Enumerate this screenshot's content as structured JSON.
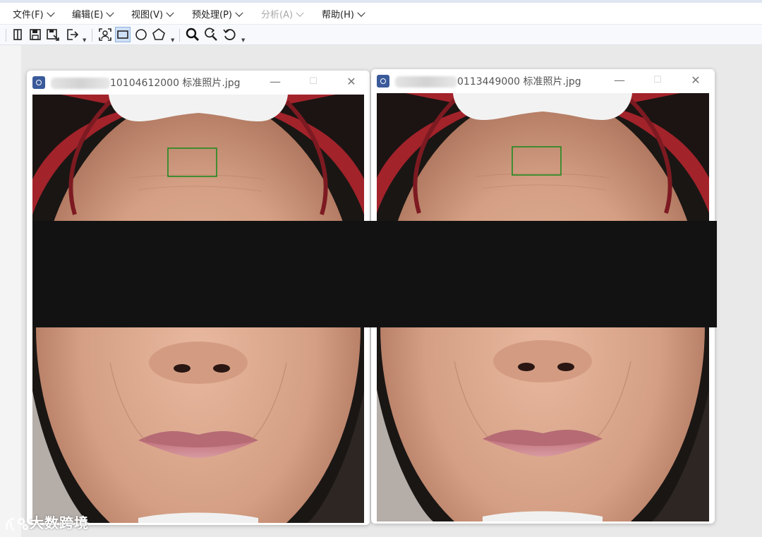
{
  "menubar": {
    "items": [
      {
        "label": "文件(F)",
        "enabled": true
      },
      {
        "label": "编辑(E)",
        "enabled": true
      },
      {
        "label": "视图(V)",
        "enabled": true
      },
      {
        "label": "预处理(P)",
        "enabled": true
      },
      {
        "label": "分析(A)",
        "enabled": false
      },
      {
        "label": "帮助(H)",
        "enabled": true
      }
    ]
  },
  "toolbar": {
    "tools": [
      "panel-toggle-icon",
      "save-icon",
      "save-as-icon",
      "export-icon",
      "roi-select-icon",
      "rectangle-tool-icon",
      "ellipse-tool-icon",
      "polygon-tool-icon",
      "zoom-in-icon",
      "zoom-reset-icon",
      "rotate-icon"
    ],
    "active_tool": "rectangle-tool-icon"
  },
  "windows": [
    {
      "title": "10104612000 标准照片.jpg"
    },
    {
      "title": "0113449000 标准照片.jpg"
    }
  ],
  "watermark": {
    "text": "大数跨境"
  },
  "colors": {
    "roi": "#1f8a1f",
    "redaction": "#121212",
    "headband": "#a3232b",
    "skin": "#d8a58a"
  }
}
